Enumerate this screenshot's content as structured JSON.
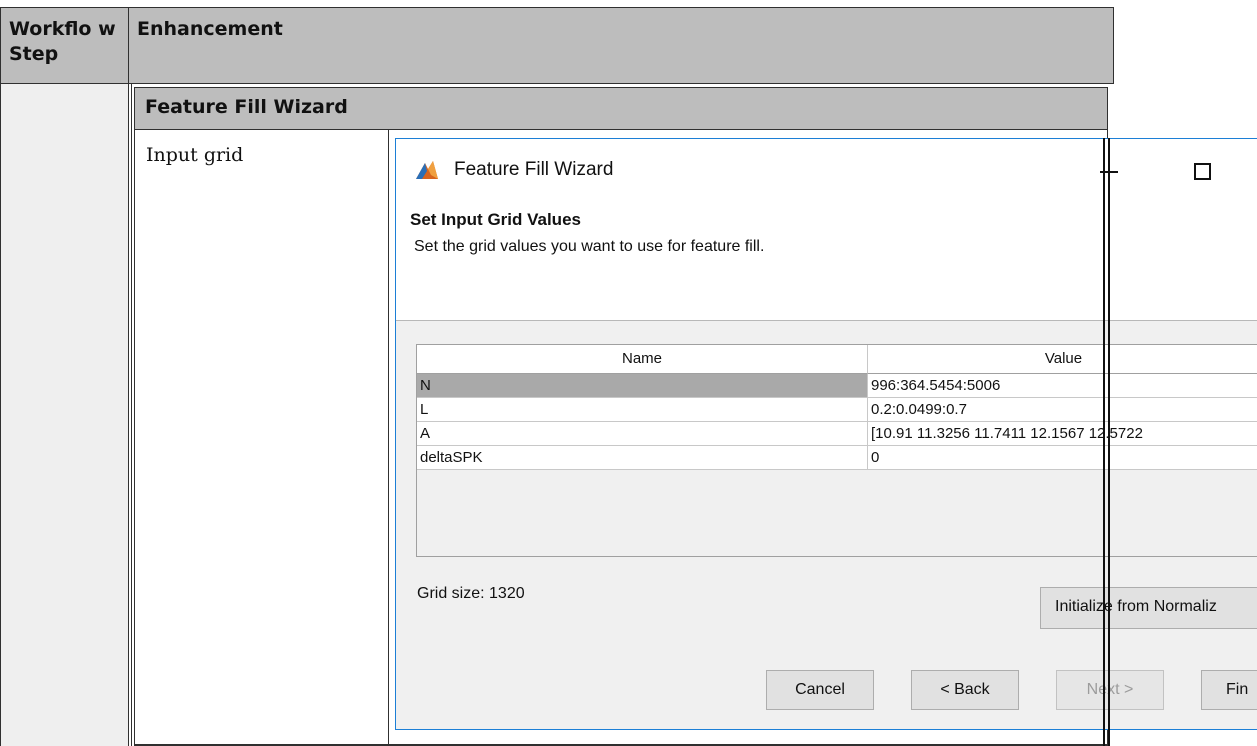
{
  "doc_table": {
    "headers": {
      "workflow_step": "Workflo w Step",
      "enhancement": "Enhancement"
    },
    "section_title": "Feature Fill Wizard",
    "row_label": "Input grid"
  },
  "wizard": {
    "title": "Feature Fill Wizard",
    "heading": "Set Input Grid Values",
    "subheading": "Set the grid values you want to use for feature fill.",
    "table": {
      "columns": [
        "Name",
        "Value"
      ],
      "rows": [
        {
          "name": "N",
          "value": "996:364.5454:5006",
          "selected": true
        },
        {
          "name": "L",
          "value": "0.2:0.0499:0.7"
        },
        {
          "name": "A",
          "value": "[10.91 11.3256 11.7411 12.1567 12.5722"
        },
        {
          "name": "deltaSPK",
          "value": "0"
        }
      ]
    },
    "grid_size": "Grid size: 1320",
    "initialize_button": "Initialize from Normaliz",
    "buttons": {
      "cancel": "Cancel",
      "back": "< Back",
      "next": "Next >",
      "finish": "Fin"
    },
    "colors": {
      "window_border": "#1c7fd6",
      "header_gray": "#bdbdbd",
      "selected_row": "#a9a9a9"
    }
  }
}
